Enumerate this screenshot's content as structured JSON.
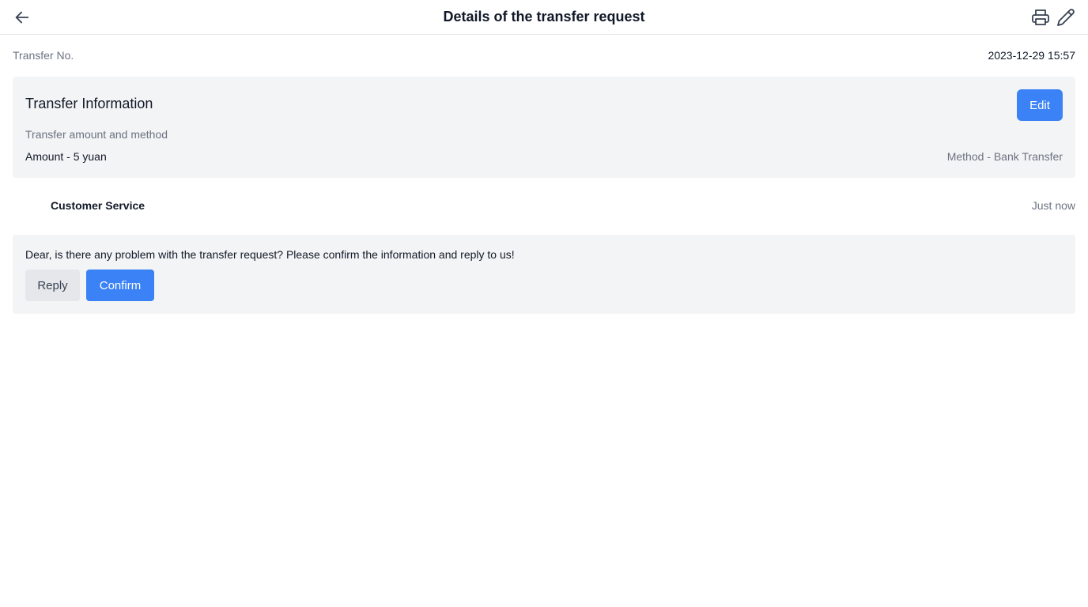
{
  "header": {
    "title": "Details of the transfer request",
    "back_icon": "arrow-left-icon",
    "print_icon": "printer-icon",
    "edit_icon": "pencil-icon"
  },
  "meta": {
    "label": "Transfer No.",
    "datetime": "2023-12-29 15:57"
  },
  "transfer_info": {
    "title": "Transfer Information",
    "edit_label": "Edit",
    "subtitle": "Transfer amount and method",
    "amount": "Amount - 5 yuan",
    "method": "Method - Bank Transfer"
  },
  "message": {
    "sender": "Customer Service",
    "time": "Just now",
    "text": "Dear, is there any problem with the transfer request? Please confirm the information and reply to us!",
    "reply_label": "Reply",
    "confirm_label": "Confirm"
  },
  "colors": {
    "accent": "#3b82f6",
    "card_bg": "#f3f4f6",
    "muted_text": "#6b7280"
  }
}
